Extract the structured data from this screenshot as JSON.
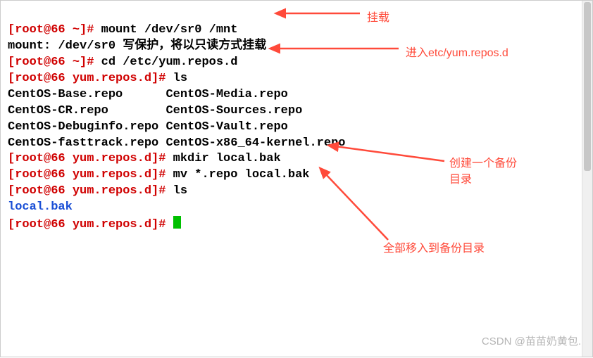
{
  "lines": [
    {
      "prompt": "[root@66 ~]#",
      "cmd": " mount /dev/sr0 /mnt"
    },
    {
      "output": "mount: /dev/sr0 写保护，将以只读方式挂载"
    },
    {
      "prompt": "[root@66 ~]#",
      "cmd": " cd /etc/yum.repos.d"
    },
    {
      "prompt": "[root@66 yum.repos.d]#",
      "cmd": " ls"
    },
    {
      "col1": "CentOS-Base.repo      ",
      "col2": "CentOS-Media.repo"
    },
    {
      "col1": "CentOS-CR.repo        ",
      "col2": "CentOS-Sources.repo"
    },
    {
      "col1": "CentOS-Debuginfo.repo ",
      "col2": "CentOS-Vault.repo"
    },
    {
      "col1": "CentOS-fasttrack.repo ",
      "col2": "CentOS-x86_64-kernel.repo"
    },
    {
      "prompt": "[root@66 yum.repos.d]#",
      "cmd": " mkdir local.bak"
    },
    {
      "prompt": "[root@66 yum.repos.d]#",
      "cmd": " mv *.repo local.bak"
    },
    {
      "prompt": "[root@66 yum.repos.d]#",
      "cmd": " ls"
    },
    {
      "dir": "local.bak"
    },
    {
      "prompt": "[root@66 yum.repos.d]#",
      "cmd": " ",
      "cursor": true
    }
  ],
  "annotations": {
    "a1": "挂载",
    "a2": "进入etc/yum.repos.d",
    "a3_line1": "创建一个备份",
    "a3_line2": "目录",
    "a4": "全部移入到备份目录"
  },
  "watermark": "CSDN @苗苗奶黄包.",
  "arrow_color": "#ff4a3a"
}
